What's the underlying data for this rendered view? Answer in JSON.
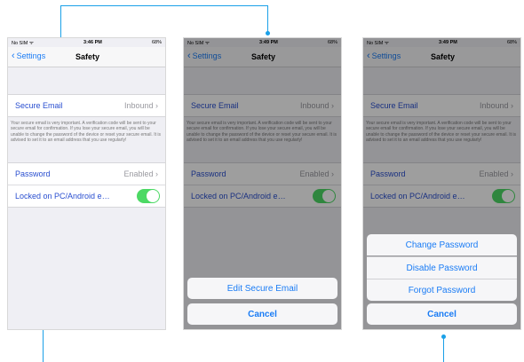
{
  "status": {
    "carrier": "No SIM ᯤ",
    "times": [
      "3:46 PM",
      "3:49 PM",
      "3:49 PM"
    ],
    "battery": "68%"
  },
  "nav": {
    "back_label": "Settings",
    "title": "Safety"
  },
  "secure_email": {
    "label": "Secure Email",
    "value": "Inbound",
    "chevron": "›"
  },
  "note": "Your secure email is very important. A verification code will be sent to your secure email for confirmation. If you lose your secure email, you will be unable to change the password of the device or reset your secure email. It is advised to set it to an email address that you use regularly!",
  "password": {
    "label": "Password",
    "value": "Enabled",
    "chevron": "›"
  },
  "locked": {
    "label": "Locked on PC/Android e…",
    "toggle_on": true
  },
  "sheet1": {
    "edit_email": "Edit Secure Email",
    "cancel": "Cancel"
  },
  "sheet2": {
    "change": "Change Password",
    "disable": "Disable Password",
    "forgot": "Forgot Password",
    "cancel": "Cancel"
  },
  "colors": {
    "accent": "#1a7cf5",
    "toggle": "#4cd964",
    "callout": "#1aa0e8"
  }
}
